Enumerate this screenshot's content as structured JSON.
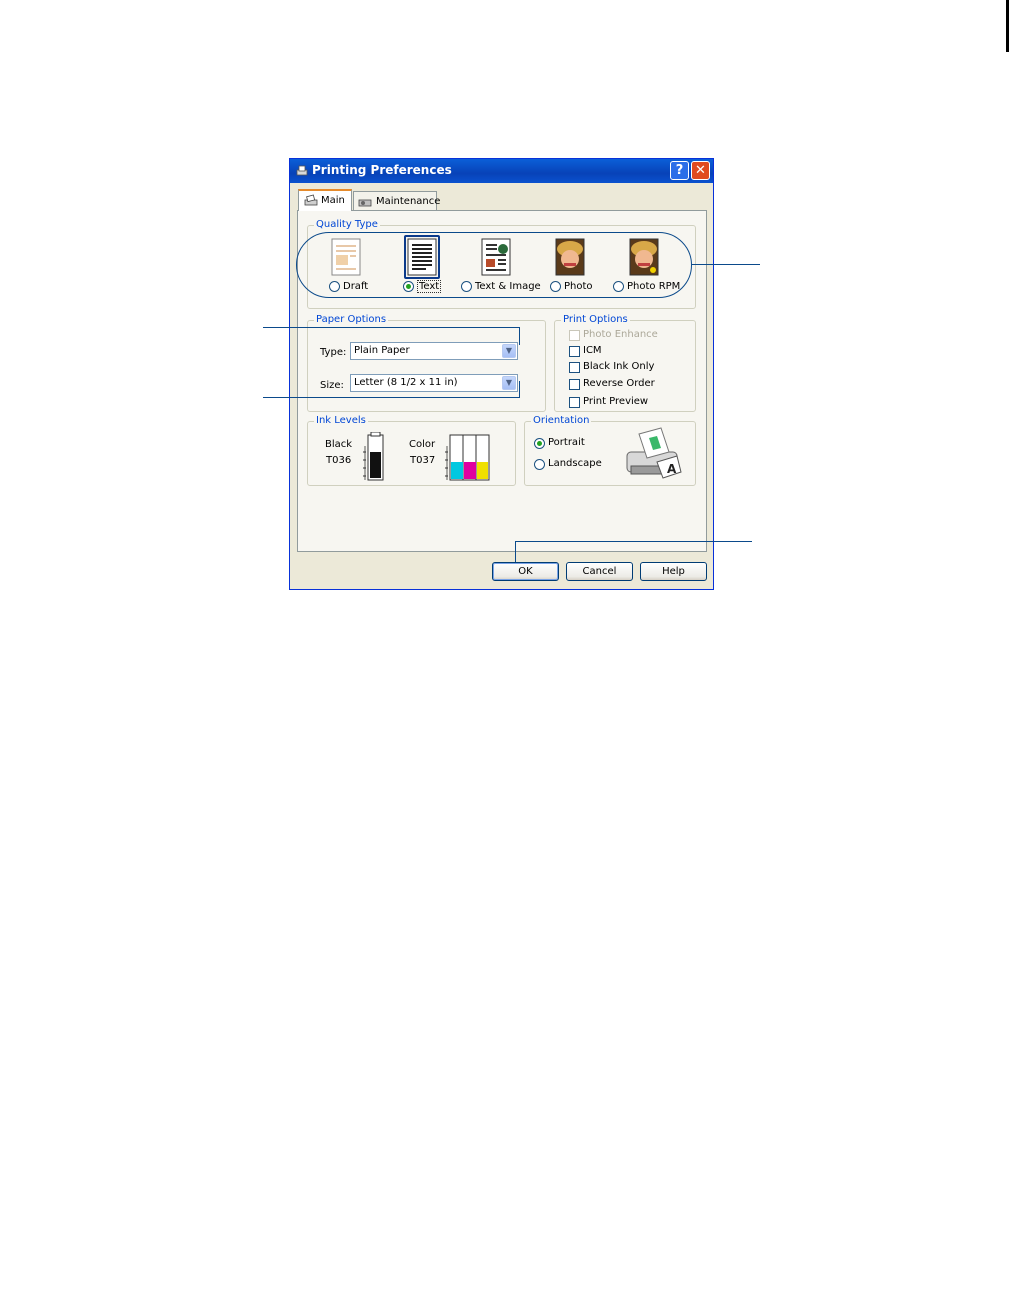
{
  "window": {
    "title": "Printing Preferences",
    "help_glyph": "?",
    "close_glyph": "✕"
  },
  "tabs": [
    {
      "label": "Main",
      "active": true
    },
    {
      "label": "Maintenance",
      "active": false
    }
  ],
  "quality_type": {
    "group_label": "Quality Type",
    "options": [
      {
        "label": "Draft",
        "icon": "draft-page-icon",
        "selected": false
      },
      {
        "label": "Text",
        "icon": "text-page-icon",
        "selected": true
      },
      {
        "label": "Text & Image",
        "icon": "text-image-page-icon",
        "selected": false
      },
      {
        "label": "Photo",
        "icon": "photo-icon",
        "selected": false
      },
      {
        "label": "Photo RPM",
        "icon": "photo-rpm-icon",
        "selected": false
      }
    ]
  },
  "paper_options": {
    "group_label": "Paper Options",
    "type_label": "Type:",
    "type_value": "Plain Paper",
    "size_label": "Size:",
    "size_value": "Letter (8 1/2 x 11 in)"
  },
  "print_options": {
    "group_label": "Print Options",
    "items": [
      {
        "label": "Photo Enhance",
        "checked": false,
        "enabled": false
      },
      {
        "label": "ICM",
        "checked": false,
        "enabled": true
      },
      {
        "label": "Black Ink Only",
        "checked": false,
        "enabled": true
      },
      {
        "label": "Reverse Order",
        "checked": false,
        "enabled": true
      },
      {
        "label": "Print Preview",
        "checked": false,
        "enabled": true
      }
    ]
  },
  "ink_levels": {
    "group_label": "Ink Levels",
    "black": {
      "name": "Black",
      "code": "T036",
      "level": 0.8
    },
    "color": {
      "name": "Color",
      "code": "T037",
      "levels": {
        "cyan": 0.35,
        "magenta": 0.35,
        "yellow": 0.35
      }
    }
  },
  "orientation": {
    "group_label": "Orientation",
    "options": [
      {
        "label": "Portrait",
        "selected": true
      },
      {
        "label": "Landscape",
        "selected": false
      }
    ]
  },
  "buttons": {
    "ok": "OK",
    "cancel": "Cancel",
    "help": "Help"
  },
  "colors": {
    "title_bar": "#0a52cf",
    "group_label": "#0046d5",
    "callout": "#0b4a8b",
    "cyan": "#00c8e0",
    "magenta": "#e000a0",
    "yellow": "#f0e000"
  }
}
